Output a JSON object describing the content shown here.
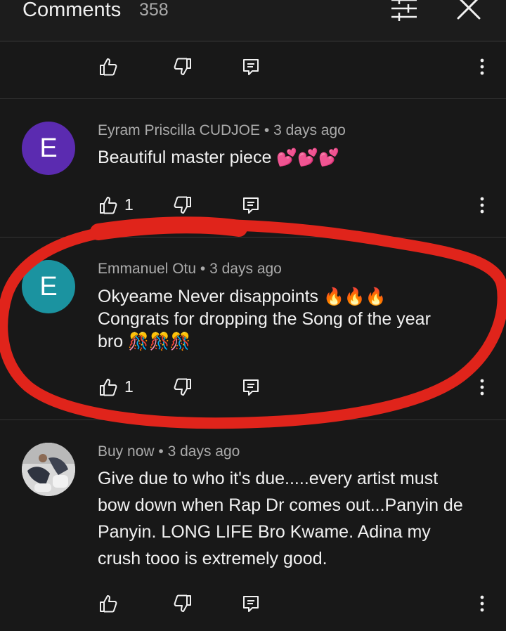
{
  "header": {
    "title": "Comments",
    "count": "358"
  },
  "comments": [
    {
      "author": "Eyram Priscilla CUDJOE",
      "time": "3 days ago",
      "avatar_letter": "E",
      "avatar_color": "#5b2bb0",
      "text": "Beautiful master piece",
      "emoji": "💕💕💕",
      "likes": "1"
    },
    {
      "author": "Emmanuel Otu",
      "time": "3 days ago",
      "avatar_letter": "E",
      "avatar_color": "#1b93a0",
      "text_line1": "Okyeame Never disappoints",
      "emoji1": "🔥🔥🔥",
      "text_line2": "Congrats for dropping the Song of the year",
      "text_line3": "bro",
      "emoji2": "🎊🎊🎊",
      "likes": "1"
    },
    {
      "author": "Buy now",
      "time": "3 days ago",
      "text_lines": [
        "Give due to who it's due.....every artist must",
        "bow down when Rap Dr comes out...Panyin de",
        "Panyin. LONG LIFE Bro Kwame. Adina my",
        "crush tooo is extremely good."
      ]
    }
  ],
  "separator": "•",
  "highlight_color": "#e0241b",
  "icons": {
    "sort": "sort-filter-icon",
    "close": "close-icon",
    "like": "thumbs-up-icon",
    "dislike": "thumbs-down-icon",
    "reply": "reply-icon",
    "more": "more-vertical-icon"
  }
}
